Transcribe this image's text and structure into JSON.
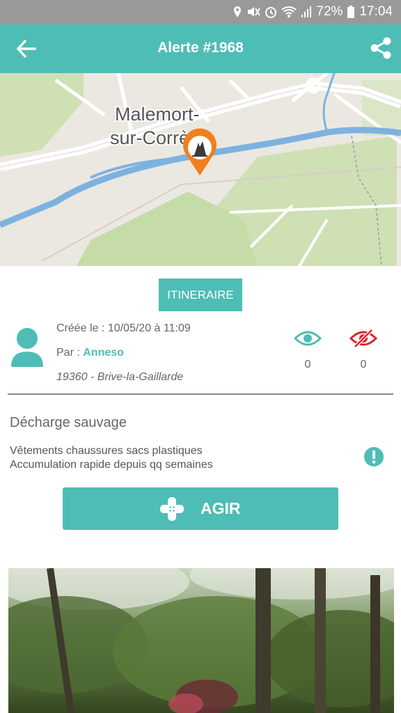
{
  "status_bar": {
    "battery": "72%",
    "time": "17:04"
  },
  "header": {
    "title": "Alerte #1968",
    "back_icon": "back-arrow-icon",
    "share_icon": "share-icon"
  },
  "map": {
    "place_line1": "Malemort-",
    "place_line2": "sur-Corrèze",
    "pin_icon": "pollution-pin-icon"
  },
  "actions": {
    "itinerary_label": "ITINERAIRE",
    "act_label": "AGIR"
  },
  "alert": {
    "created_label": "Créée le : 10/05/20 à 11:09",
    "by_prefix": "Par : ",
    "author": "Anneso",
    "location": "19360 - Brive-la-Gaillarde",
    "seen_count": "0",
    "unseen_count": "0",
    "category": "Décharge sauvage",
    "description_line1": "Vêtements chaussures sacs plastiques",
    "description_line2": "Accumulation rapide depuis qq semaines"
  },
  "colors": {
    "accent": "#4ebdb5",
    "status_bar": "#999999",
    "danger": "#d9262d",
    "pin": "#f07f1e"
  }
}
